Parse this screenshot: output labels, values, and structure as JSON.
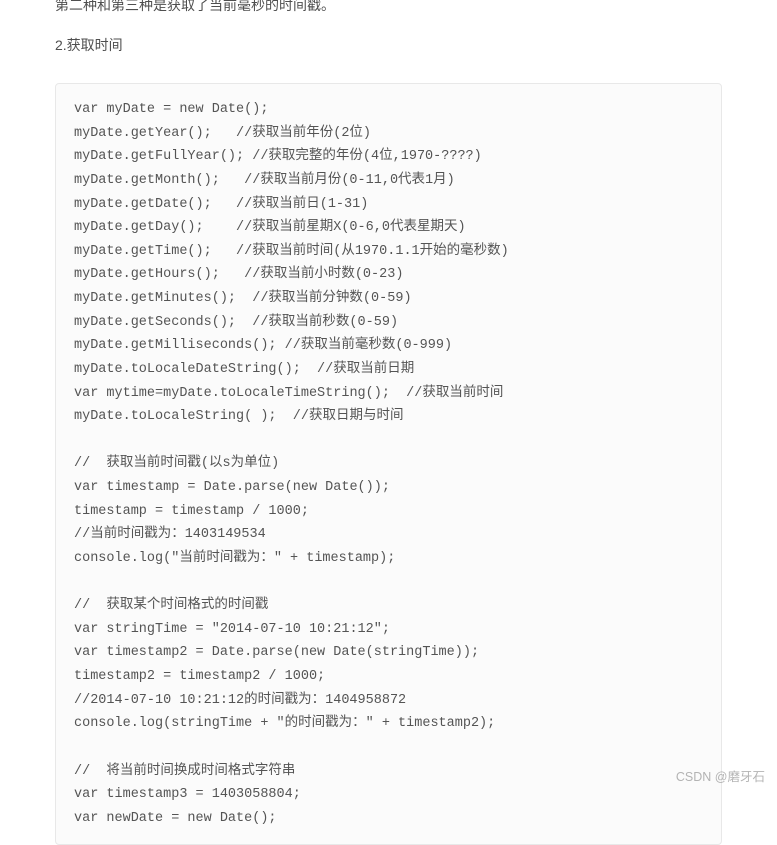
{
  "article": {
    "top_text": "第二种和第三种是获取了当前毫秒的时间戳。",
    "section_title": "2.获取时间",
    "code_lines": [
      "var myDate = new Date();",
      "myDate.getYear();   //获取当前年份(2位)",
      "myDate.getFullYear(); //获取完整的年份(4位,1970-????)",
      "myDate.getMonth();   //获取当前月份(0-11,0代表1月)",
      "myDate.getDate();   //获取当前日(1-31)",
      "myDate.getDay();    //获取当前星期X(0-6,0代表星期天)",
      "myDate.getTime();   //获取当前时间(从1970.1.1开始的毫秒数)",
      "myDate.getHours();   //获取当前小时数(0-23)",
      "myDate.getMinutes();  //获取当前分钟数(0-59)",
      "myDate.getSeconds();  //获取当前秒数(0-59)",
      "myDate.getMilliseconds(); //获取当前毫秒数(0-999)",
      "myDate.toLocaleDateString();  //获取当前日期",
      "var mytime=myDate.toLocaleTimeString();  //获取当前时间",
      "myDate.toLocaleString( );  //获取日期与时间",
      "",
      "//  获取当前时间戳(以s为单位)",
      "var timestamp = Date.parse(new Date());",
      "timestamp = timestamp / 1000;",
      "//当前时间戳为：1403149534",
      "console.log(\"当前时间戳为：\" + timestamp);",
      "",
      "//  获取某个时间格式的时间戳",
      "var stringTime = \"2014-07-10 10:21:12\";",
      "var timestamp2 = Date.parse(new Date(stringTime));",
      "timestamp2 = timestamp2 / 1000;",
      "//2014-07-10 10:21:12的时间戳为：1404958872",
      "console.log(stringTime + \"的时间戳为：\" + timestamp2);",
      "",
      "//  将当前时间换成时间格式字符串",
      "var timestamp3 = 1403058804;",
      "var newDate = new Date();"
    ]
  },
  "watermark": {
    "site": "CSDN",
    "author": "@磨牙石"
  }
}
